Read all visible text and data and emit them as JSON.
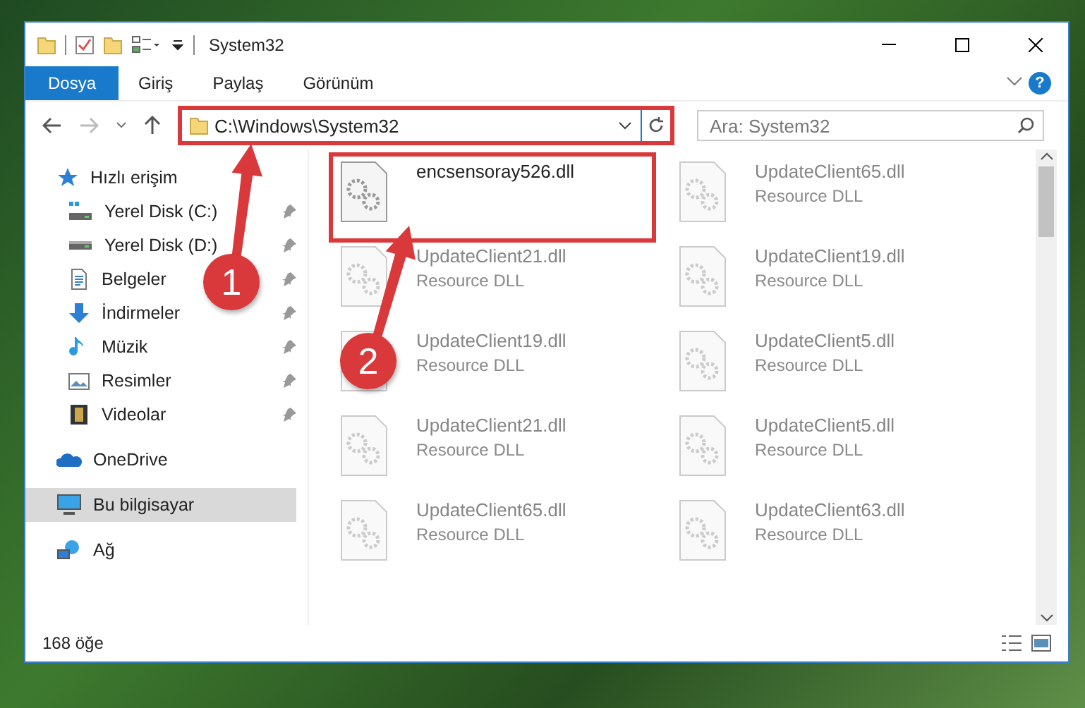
{
  "window": {
    "title": "System32"
  },
  "ribbon_tabs": [
    {
      "label": "Dosya",
      "selected": true
    },
    {
      "label": "Giriş",
      "selected": false
    },
    {
      "label": "Paylaş",
      "selected": false
    },
    {
      "label": "Görünüm",
      "selected": false
    }
  ],
  "help": {
    "label": "?"
  },
  "address": {
    "value": "C:\\Windows\\System32",
    "highlighted": true
  },
  "search": {
    "placeholder": "Ara: System32"
  },
  "sidebar": {
    "items": [
      {
        "label": "Hızlı erişim",
        "kind": "star",
        "selected": false,
        "children": [
          {
            "label": "Yerel Disk (C:)",
            "kind": "drive-c",
            "pinned": true,
            "selected": false
          },
          {
            "label": "Yerel Disk (D:)",
            "kind": "drive",
            "pinned": true,
            "selected": false
          },
          {
            "label": "Belgeler",
            "kind": "documents",
            "pinned": true,
            "selected": false
          },
          {
            "label": "İndirmeler",
            "kind": "download",
            "pinned": true,
            "selected": false
          },
          {
            "label": "Müzik",
            "kind": "music",
            "pinned": true,
            "selected": false
          },
          {
            "label": "Resimler",
            "kind": "pictures",
            "pinned": true,
            "selected": false
          },
          {
            "label": "Videolar",
            "kind": "videos",
            "pinned": true,
            "selected": false
          }
        ]
      },
      {
        "label": "OneDrive",
        "kind": "cloud",
        "selected": false
      },
      {
        "label": "Bu bilgisayar",
        "kind": "computer",
        "selected": true
      },
      {
        "label": "Ağ",
        "kind": "network",
        "selected": false
      }
    ]
  },
  "files": [
    {
      "name": "encsensoray526.dll",
      "highlighted": true,
      "blurred": false
    },
    {
      "name": "UpdateClient65.dll",
      "type": "Resource DLL",
      "highlighted": false,
      "blurred": true
    },
    {
      "name": "UpdateClient21.dll",
      "type": "Resource DLL",
      "highlighted": false,
      "blurred": true
    },
    {
      "name": "UpdateClient19.dll",
      "type": "Resource DLL",
      "highlighted": false,
      "blurred": true
    },
    {
      "name": "UpdateClient19.dll",
      "type": "Resource DLL",
      "highlighted": false,
      "blurred": true
    },
    {
      "name": "UpdateClient5.dll",
      "type": "Resource DLL",
      "highlighted": false,
      "blurred": true
    },
    {
      "name": "UpdateClient21.dll",
      "type": "Resource DLL",
      "highlighted": false,
      "blurred": true
    },
    {
      "name": "UpdateClient5.dll",
      "type": "Resource DLL",
      "highlighted": false,
      "blurred": true
    },
    {
      "name": "UpdateClient65.dll",
      "type": "Resource DLL",
      "highlighted": false,
      "blurred": true
    },
    {
      "name": "UpdateClient63.dll",
      "type": "Resource DLL",
      "highlighted": false,
      "blurred": true
    }
  ],
  "status_bar": {
    "count": "168 öğe"
  },
  "callouts": [
    {
      "label": "1"
    },
    {
      "label": "2"
    }
  ]
}
